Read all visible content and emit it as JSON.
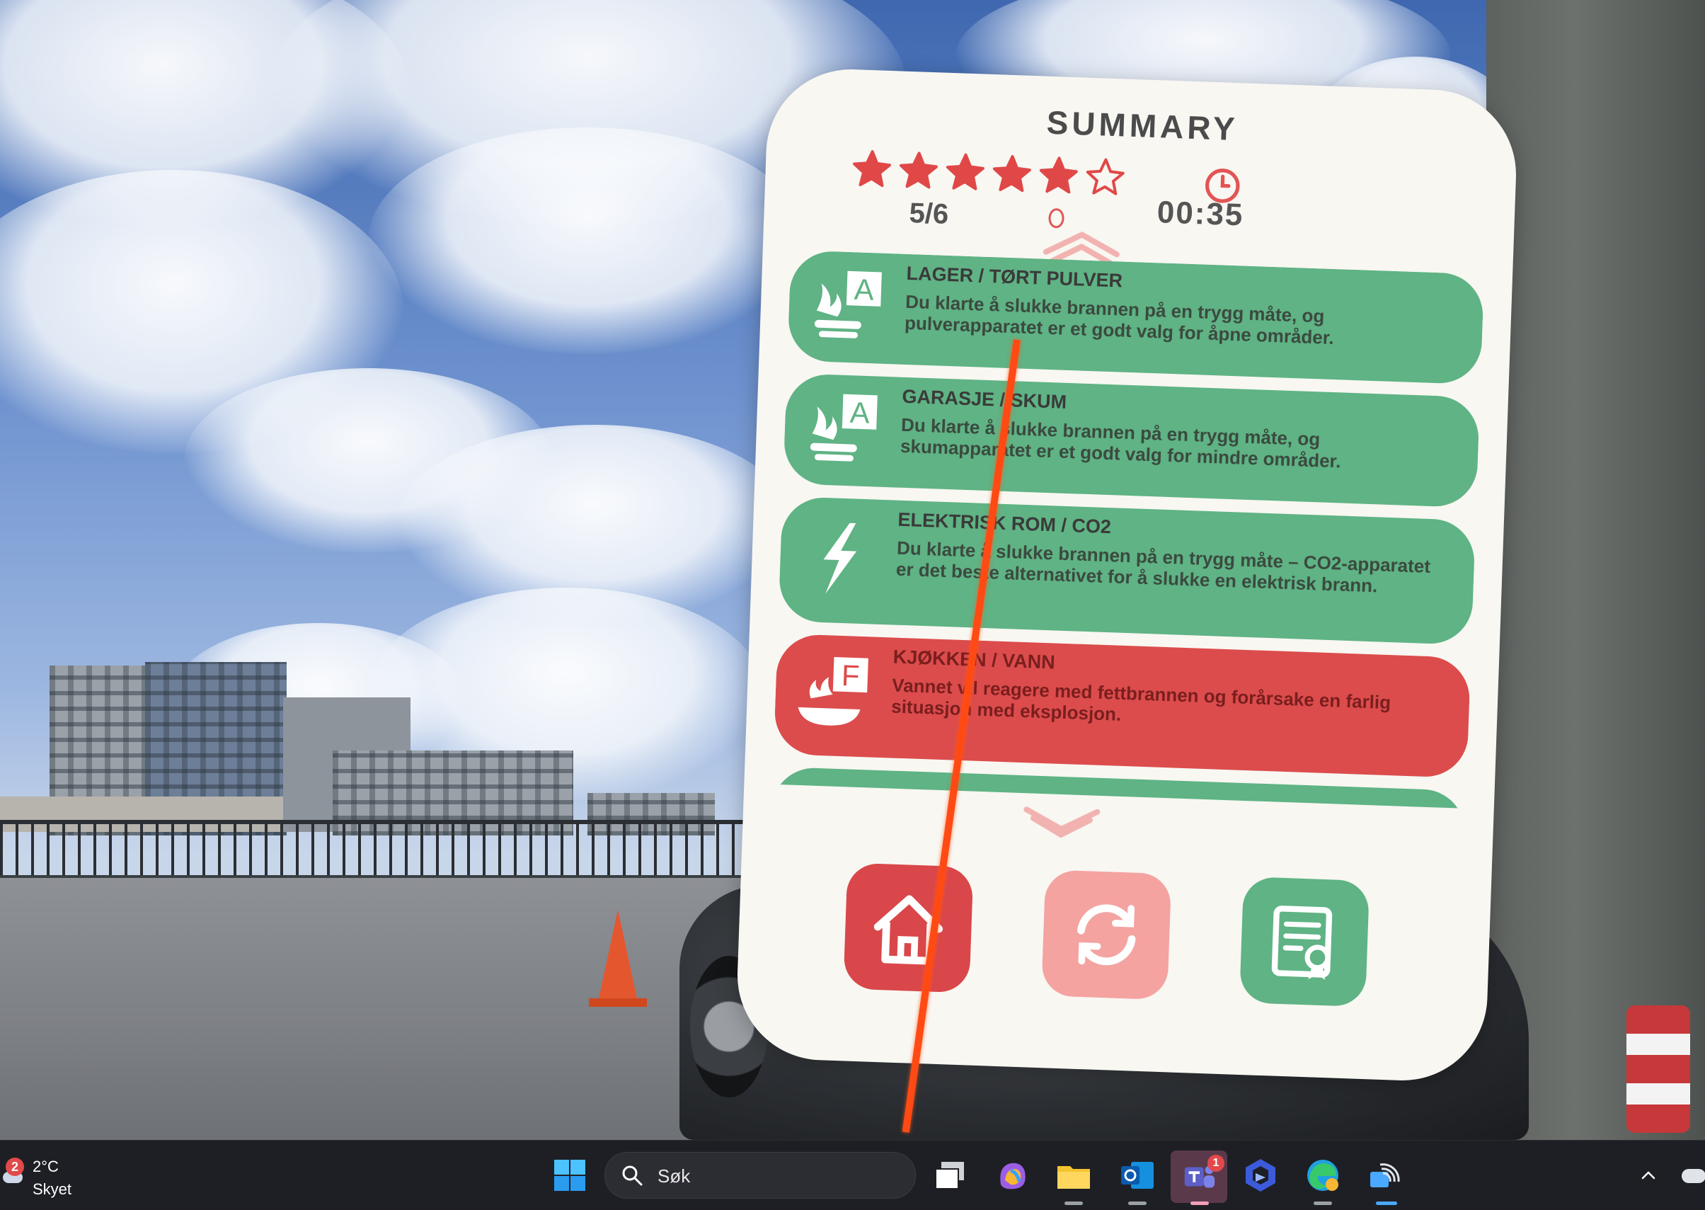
{
  "summary": {
    "title": "SUMMARY",
    "rating": {
      "score": 5,
      "max": 6,
      "text": "5/6"
    },
    "timer": "00:35",
    "colors": {
      "good": "#5fb384",
      "bad": "#dc4c4c",
      "star": "#e04848"
    },
    "results": [
      {
        "status": "good",
        "icon": "fire-class-a-icon",
        "icon_letter": "A",
        "title": "LAGER / TØRT PULVER",
        "description": "Du klarte å slukke brannen på en trygg måte, og pulverapparatet er et godt valg for åpne områder."
      },
      {
        "status": "good",
        "icon": "fire-class-a-icon",
        "icon_letter": "A",
        "title": "GARASJE / SKUM",
        "description": "Du klarte å slukke brannen på en trygg måte, og skumapparatet er et godt valg for mindre områder."
      },
      {
        "status": "good",
        "icon": "lightning-icon",
        "icon_letter": "",
        "title": "ELEKTRISK ROM / CO2",
        "description": "Du klarte å slukke brannen på en trygg måte – CO2-apparatet er det beste alternativet for å slukke en elektrisk brann."
      },
      {
        "status": "bad",
        "icon": "fire-class-f-icon",
        "icon_letter": "F",
        "title": "KJØKKEN / VANN",
        "description": "Vannet vil reagere med fettbrannen og forårsake en farlig situasjon med eksplosjon."
      }
    ],
    "buttons": {
      "home": {
        "icon": "home-icon",
        "color": "#d9474a"
      },
      "restart": {
        "icon": "restart-icon",
        "color": "#f4a3a1"
      },
      "certificate": {
        "icon": "certificate-icon",
        "color": "#5fb384"
      }
    }
  },
  "taskbar": {
    "weather": {
      "temperature": "2°C",
      "condition": "Skyet",
      "badge": "2"
    },
    "search": {
      "placeholder": "Søk"
    },
    "apps": [
      "start-icon",
      "search-icon",
      "task-view-icon",
      "copilot-icon",
      "file-explorer-icon",
      "outlook-icon",
      "teams-icon",
      "bing-icon",
      "edge-icon",
      "cast-icon"
    ],
    "teams_badge": "1"
  }
}
